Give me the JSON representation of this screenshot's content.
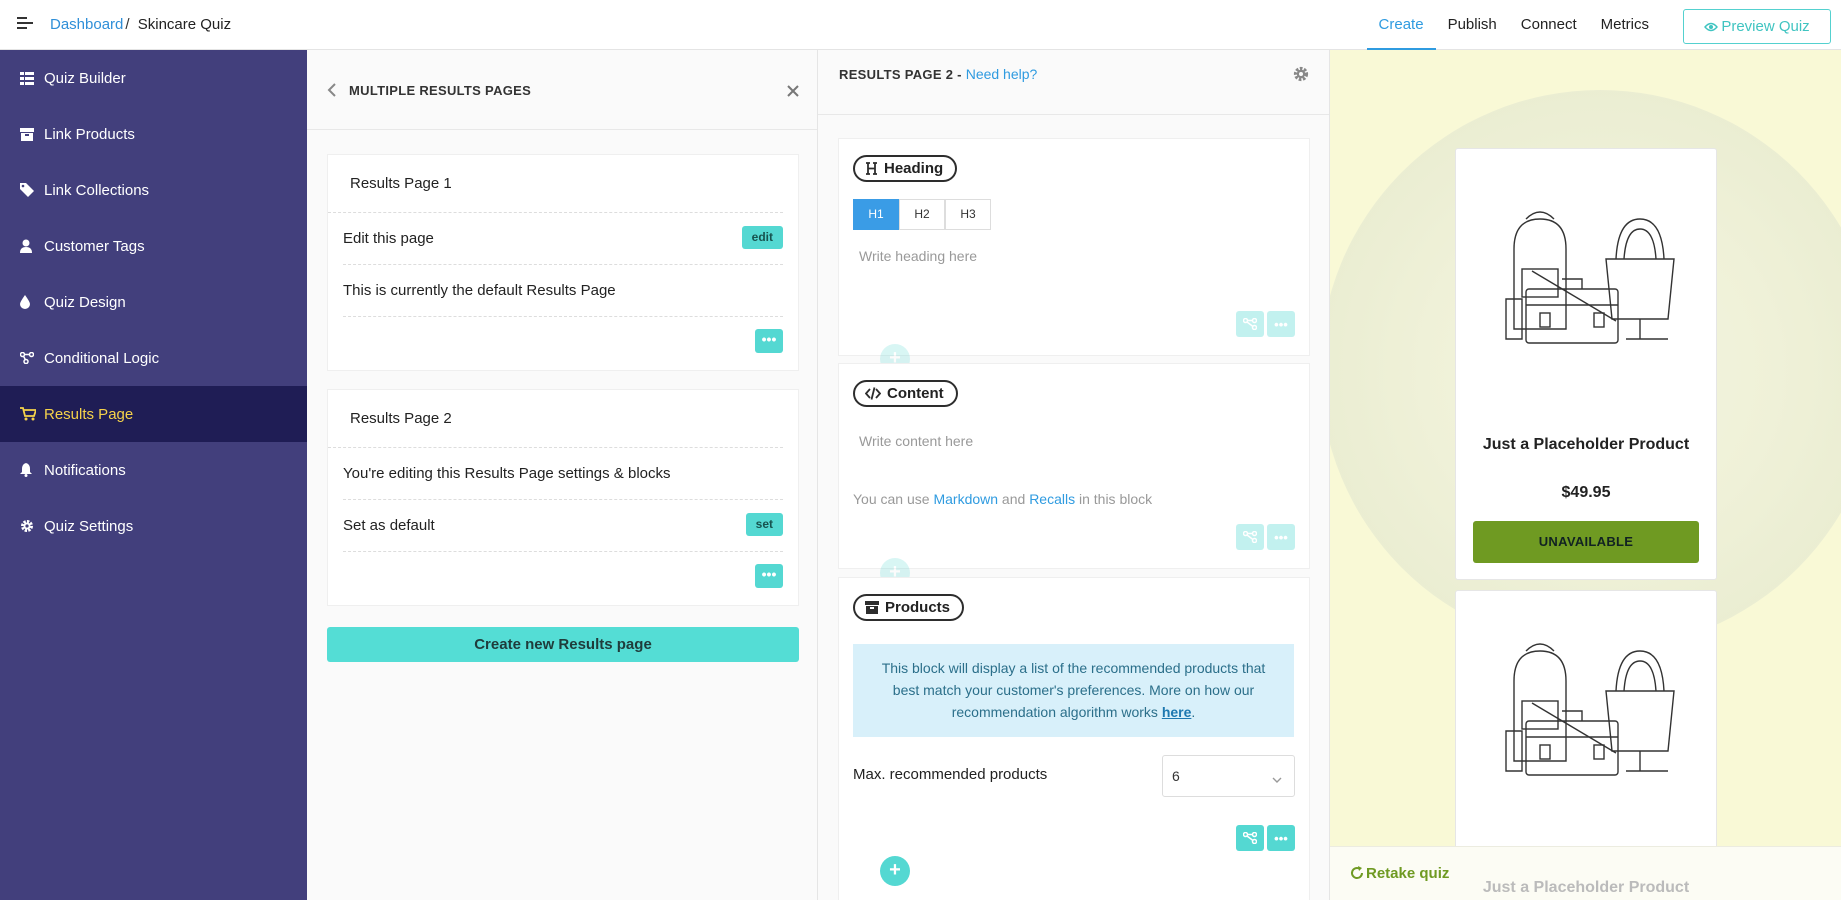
{
  "topbar": {
    "breadcrumb_link": "Dashboard",
    "breadcrumb_sep": "/",
    "breadcrumb_current": "Skincare Quiz",
    "nav": [
      {
        "label": "Create",
        "active": true
      },
      {
        "label": "Publish",
        "active": false
      },
      {
        "label": "Connect",
        "active": false
      },
      {
        "label": "Metrics",
        "active": false
      }
    ],
    "preview_label": "Preview Quiz"
  },
  "sidebar": {
    "items": [
      {
        "label": "Quiz Builder",
        "icon": "list-icon"
      },
      {
        "label": "Link Products",
        "icon": "box-icon"
      },
      {
        "label": "Link Collections",
        "icon": "tag-icon"
      },
      {
        "label": "Customer Tags",
        "icon": "user-icon"
      },
      {
        "label": "Quiz Design",
        "icon": "drop-icon"
      },
      {
        "label": "Conditional Logic",
        "icon": "branch-icon"
      },
      {
        "label": "Results Page",
        "icon": "cart-icon",
        "active": true
      },
      {
        "label": "Notifications",
        "icon": "bell-icon"
      },
      {
        "label": "Quiz Settings",
        "icon": "gear-icon"
      }
    ]
  },
  "results_panel": {
    "title": "MULTIPLE RESULTS PAGES",
    "pages": [
      {
        "title": "Results Page 1",
        "rows": [
          {
            "text": "Edit this page",
            "button": "edit"
          },
          {
            "text": "This is currently the default Results Page",
            "button": ""
          }
        ]
      },
      {
        "title": "Results Page 2",
        "rows": [
          {
            "text": "You're editing this Results Page settings & blocks",
            "button": ""
          },
          {
            "text": "Set as default",
            "button": "set"
          }
        ]
      }
    ],
    "more_label": "•••",
    "create_label": "Create new Results page"
  },
  "editor": {
    "title": "RESULTS PAGE 2 - ",
    "help": "Need help?",
    "heading_block": {
      "label": "Heading",
      "levels": [
        "H1",
        "H2",
        "H3"
      ],
      "active_level": "H1",
      "placeholder": "Write heading here"
    },
    "content_block": {
      "label": "Content",
      "placeholder": "Write content here",
      "hint_prefix": "You can use ",
      "hint_markdown": "Markdown",
      "hint_and": " and ",
      "hint_recalls": "Recalls",
      "hint_suffix": " in this block"
    },
    "products_block": {
      "label": "Products",
      "info_text": "This block will display a list of the recommended products that best match your customer's preferences. More on how our recommendation algorithm works ",
      "info_link": "here",
      "info_end": ".",
      "max_label": "Max. recommended products",
      "max_value": "6"
    },
    "plus": "+",
    "dots": "•••"
  },
  "preview": {
    "products": [
      {
        "name": "Just a Placeholder Product",
        "price": "$49.95",
        "button": "UNAVAILABLE"
      }
    ],
    "second_name": "Just a Placeholder Product",
    "retake_label": "Retake quiz"
  },
  "colors": {
    "sidebar_bg": "#423f7c",
    "sidebar_active": "#1f1d55",
    "accent_teal": "#54d8d2",
    "link_blue": "#2f9be0",
    "unavailable_green": "#6f9a22"
  }
}
